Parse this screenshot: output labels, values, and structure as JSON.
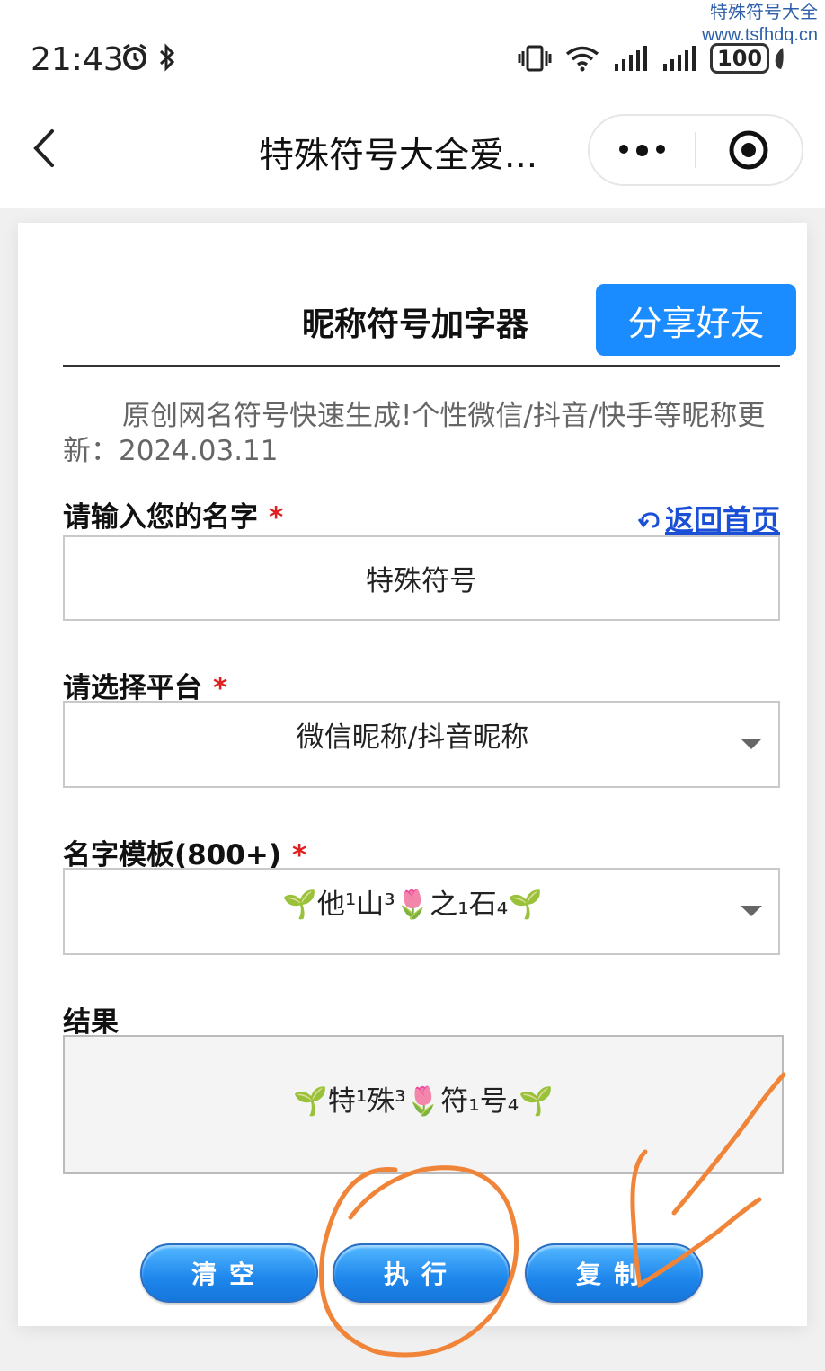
{
  "watermark": {
    "line1": "特殊符号大全",
    "line2": "www.tsfhdq.cn"
  },
  "status_bar": {
    "time": "21:43",
    "battery": "100"
  },
  "nav": {
    "title": "特殊符号大全爱..."
  },
  "page": {
    "title": "昵称符号加字器",
    "share_label": "分享好友",
    "description": "原创网名符号快速生成!个性微信/抖音/快手等昵称更新：2024.03.11"
  },
  "form": {
    "name_label": "请输入您的名字",
    "required_mark": "*",
    "home_link": "返回首页",
    "name_value": "特殊符号",
    "platform_label": "请选择平台",
    "platform_value": "微信昵称/抖音昵称",
    "template_label": "名字模板(800+)",
    "template_value": "🌱他¹山³🌷之₁石₄🌱",
    "result_label": "结果",
    "result_value": "🌱特¹殊³🌷符₁号₄🌱"
  },
  "buttons": {
    "clear": "清空",
    "execute": "执行",
    "copy": "复制"
  },
  "colors": {
    "accent": "#1a8cff",
    "link": "#1a4fd6",
    "required": "#e02020",
    "annotation": "#f0853a"
  }
}
